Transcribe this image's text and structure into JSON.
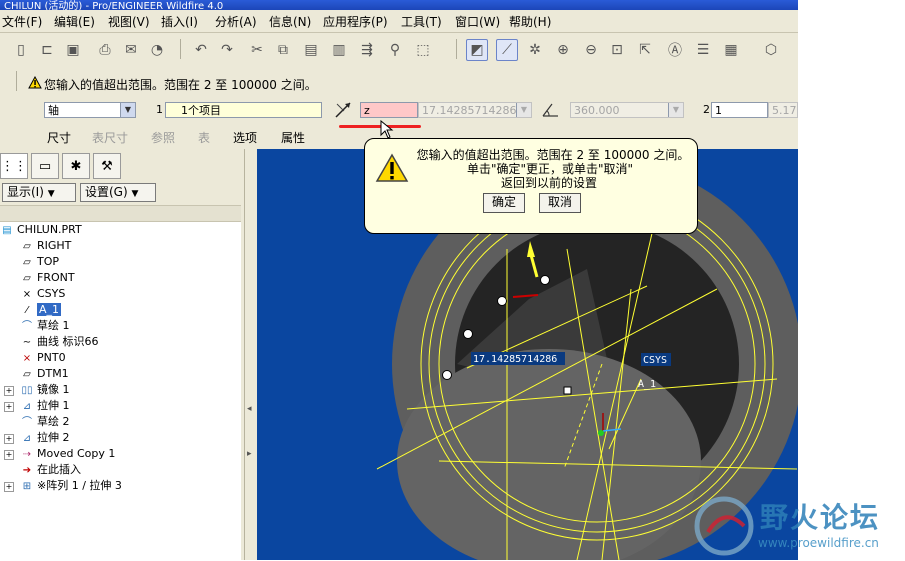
{
  "window": {
    "title": "CHILUN (活动的) - Pro/ENGINEER Wildfire 4.0"
  },
  "menu": [
    "文件(F)",
    "编辑(E)",
    "视图(V)",
    "插入(I)",
    "分析(A)",
    "信息(N)",
    "应用程序(P)",
    "工具(T)",
    "窗口(W)",
    "帮助(H)"
  ],
  "dashboard": {
    "message": "您输入的值超出范围。范围在 2 至 100000 之间。",
    "axis_select": "轴",
    "ref_index": "1",
    "ref_field": "1个项目",
    "input_value": "z",
    "disabled_value": "17.14285714286",
    "angle_value": "360.000",
    "count_index": "2",
    "count_value": "1",
    "count_trailing": "5.17",
    "tabs": [
      "尺寸",
      "表尺寸",
      "参照",
      "表",
      "选项",
      "属性"
    ]
  },
  "panel": {
    "show_button": "显示(I)",
    "settings_button": "设置(G)",
    "tree": [
      "CHILUN.PRT",
      "RIGHT",
      "TOP",
      "FRONT",
      "CSYS",
      "A_1",
      "草绘 1",
      "曲线 标识66",
      "PNT0",
      "DTM1",
      "镜像 1",
      "拉伸 1",
      "草绘 2",
      "拉伸 2",
      "Moved Copy 1",
      "在此插入",
      "※阵列 1 / 拉伸 3"
    ]
  },
  "viewport": {
    "dim_label": "17.14285714286",
    "csys_label": "CSYS",
    "axis_label": "A_1"
  },
  "popup": {
    "line1": "您输入的值超出范围。范围在 2 至 100000 之间。",
    "line2": "单击\"确定\"更正，或单击\"取消\"",
    "line3": "返回到以前的设置",
    "ok": "确定",
    "cancel": "取消"
  },
  "watermark": {
    "title": "野火论坛",
    "url": "www.proewildfire.cn"
  },
  "colors": {
    "viewport_bg": "#0a46a0",
    "model_edge": "#ffff33",
    "warning_field": "#ffc8c8",
    "tooltip_bg": "#ffffe1"
  }
}
